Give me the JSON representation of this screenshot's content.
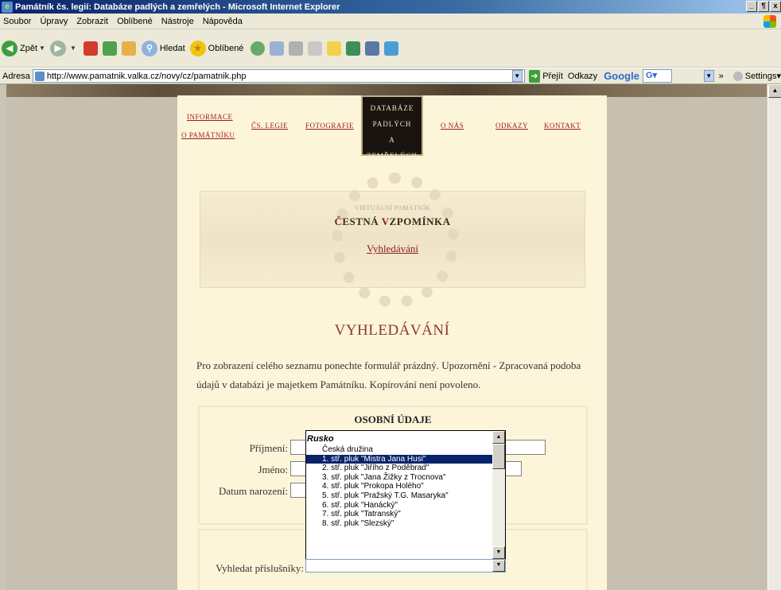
{
  "window": {
    "title": "Památník čs. legií: Databáze padlých a zemřelých - Microsoft Internet Explorer",
    "buttons": [
      "_",
      "¶",
      "x"
    ]
  },
  "menu": [
    "Soubor",
    "Úpravy",
    "Zobrazit",
    "Oblíbené",
    "Nástroje",
    "Nápověda"
  ],
  "toolbar": {
    "back": "Zpět",
    "search": "Hledat",
    "favorites": "Oblíbené"
  },
  "address": {
    "label": "Adresa",
    "url": "http://www.pamatnik.valka.cz/novy/cz/pamatnik.php",
    "go": "Přejít",
    "links": "Odkazy",
    "google": "Google",
    "google_field": "G▾",
    "settings": "Settings▾",
    "chevron": "»"
  },
  "nav": {
    "info_line1": "INFORMACE",
    "info_line2": "O PAMÁTNÍKU",
    "legie": "ČS. LEGIE",
    "foto": "FOTOGRAFIE",
    "db_line1": "DATABÁZE",
    "db_line2": "PADLÝCH",
    "db_line3": "A ZEMŘELÝCH",
    "nas": "O NÁS",
    "odkazy": "ODKAZY",
    "kontakt": "KONTAKT"
  },
  "memorial": {
    "small": "VIRTUÁLNÍ PAMÁTNÍK",
    "title_c": "Č",
    "title_rest1": "ESTNÁ ",
    "title_v": "V",
    "title_rest2": "ZPOMÍNKA",
    "link": "Vyhledávání"
  },
  "page": {
    "heading": "VYHLEDÁVÁNÍ",
    "intro": "Pro zobrazení celého seznamu ponechte formulář prázdný. Upozornění - Zpracovaná podoba údajů v databázi je majetkem Památníku. Kopírování není povoleno."
  },
  "form": {
    "section_title": "OSOBNÍ ÚDAJE",
    "surname_label": "Příjmení:",
    "name_label": "Jméno:",
    "birth_label": "Datum narození:",
    "members_label": "Vyhledat příslušníky:"
  },
  "listbox": {
    "group": "Rusko",
    "items": [
      "Česká družina",
      "1. stř. pluk \"Mistra Jana Husi\"",
      "2. stř. pluk \"Jiřího z Poděbrad\"",
      "3. stř. pluk \"Jana Žižky z Trocnova\"",
      "4. stř. pluk \"Prokopa Holého\"",
      "5. stř. pluk \"Pražský T.G. Masaryka\"",
      "6. stř. pluk \"Hanácký\"",
      "7. stř. pluk \"Tatranský\"",
      "8. stř. pluk \"Slezský\""
    ],
    "selected_index": 1
  }
}
